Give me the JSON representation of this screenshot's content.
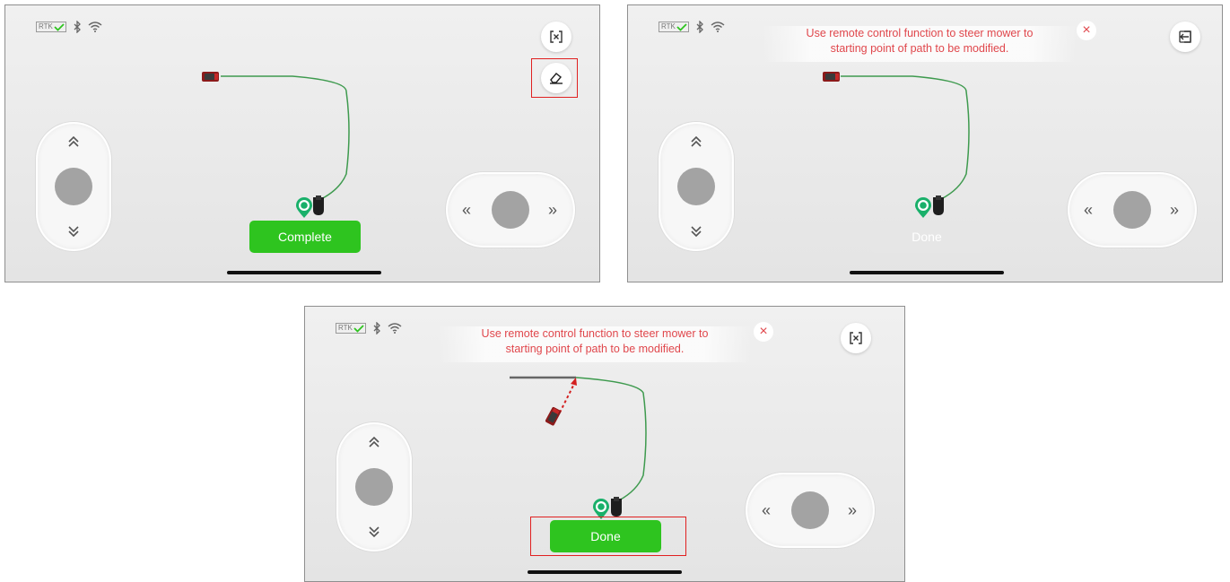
{
  "status": {
    "rtk_label": "RTK",
    "icons": [
      "rtk-check-icon",
      "bluetooth-icon",
      "wifi-icon"
    ]
  },
  "colors": {
    "accent_green": "#2ec41f",
    "path_green": "#3e9a4e",
    "hint_red": "#e0474c",
    "highlight_red": "#e02020",
    "dock_pin": "#19b06a"
  },
  "screens": [
    {
      "name": "edit-path-start",
      "top_buttons": [
        "exit-edit-icon",
        "eraser-icon"
      ],
      "action_button": "Complete",
      "action_state": "enabled"
    },
    {
      "name": "steer-to-start",
      "hint_text_line1": "Use remote control function to steer mower to",
      "hint_text_line2": "starting point of path to be modified.",
      "hint_close": "×",
      "top_buttons": [
        "exit-icon"
      ],
      "action_button": "Done",
      "action_state": "disabled"
    },
    {
      "name": "mower-at-start",
      "hint_text_line1": "Use remote control function to steer mower to",
      "hint_text_line2": "starting point of path to be modified.",
      "hint_close": "×",
      "top_buttons": [
        "exit-edit-icon"
      ],
      "action_button": "Done",
      "action_state": "enabled"
    }
  ],
  "joystick": {
    "up": "⌃",
    "down": "⌄",
    "left": "«",
    "right": "»"
  }
}
